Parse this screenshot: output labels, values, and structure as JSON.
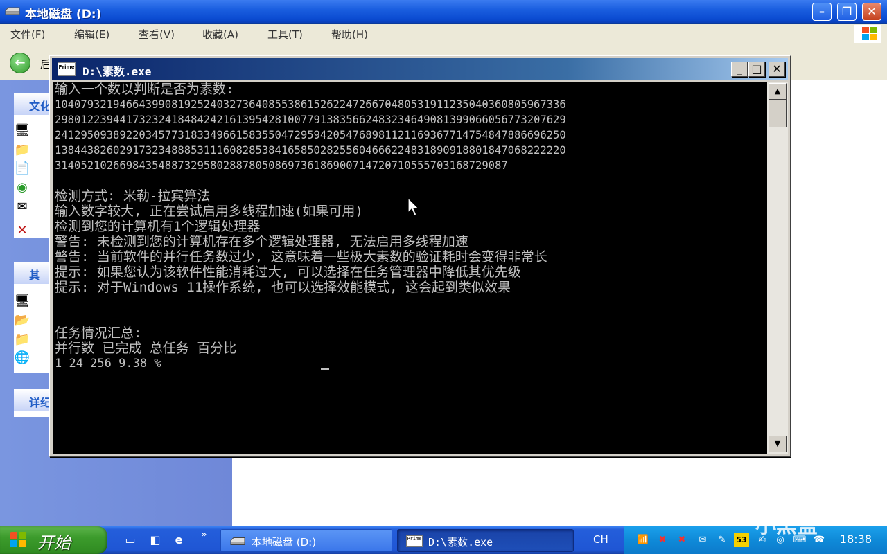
{
  "explorer": {
    "title": "本地磁盘  (D:)",
    "menu": [
      "文件(F)",
      "编辑(E)",
      "查看(V)",
      "收藏(A)",
      "工具(T)",
      "帮助(H)"
    ],
    "back_label": "后",
    "task_pane_headers": [
      "文化",
      "其",
      "详纪"
    ]
  },
  "console": {
    "title": "D:\\素数.exe",
    "icon_text": "Prime",
    "lines": [
      "输入一个数以判断是否为素数:",
      "1040793219466439908192524032736408553861526224726670480531911235040360805967336",
      "2980122394417323241848424216139542810077913835662483234649081399066056773207629",
      "2412950938922034577318334966158355047295942054768981121169367714754847886696250",
      "1384438260291732348885311160828538416585028255604666224831890918801847068222220",
      "3140521026698435488732958028878050869736186900714720710555703168729087",
      "",
      "检测方式: 米勒-拉宾算法",
      "输入数字较大, 正在尝试启用多线程加速(如果可用)",
      "检测到您的计算机有1个逻辑处理器",
      "警告: 未检测到您的计算机存在多个逻辑处理器, 无法启用多线程加速",
      "警告: 当前软件的并行任务数过少, 这意味着一些极大素数的验证耗时会变得非常长",
      "提示: 如果您认为该软件性能消耗过大, 可以选择在任务管理器中降低其优先级",
      "提示: 对于Windows 11操作系统, 也可以选择效能模式, 这会起到类似效果",
      "",
      "",
      "任务情况汇总:",
      "并行数  已完成  总任务  百分比",
      "1       24      256     9.38 %"
    ]
  },
  "taskbar": {
    "start_label": "开始",
    "tasks": [
      "本地磁盘  (D:)",
      "D:\\素数.exe"
    ],
    "language": "CH",
    "clock": "18:38",
    "tray_badge": "53",
    "watermark": "小黑盒"
  },
  "colors": {
    "console_bg": "#000000",
    "console_text": "#c0c0c0",
    "xp_blue": "#245edb",
    "start_green": "#3c9b2c"
  }
}
